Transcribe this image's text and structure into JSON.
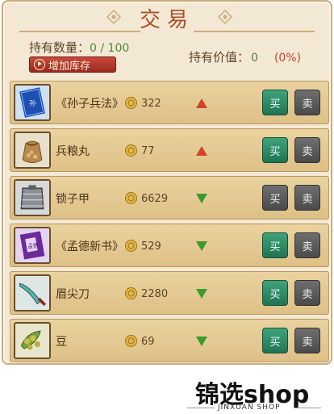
{
  "header": {
    "title": "交易"
  },
  "holdings": {
    "label": "持有数量：",
    "count": "0 / 100"
  },
  "add_storage": {
    "label": "增加库存"
  },
  "holding_value": {
    "label": "持有价值：",
    "value": "0",
    "percent": "(0%)"
  },
  "buttons": {
    "buy_label": "买",
    "sell_label": "卖"
  },
  "colors": {
    "trend_up": "#d2432b",
    "trend_down": "#3a9a2a",
    "button_active": "#2d8a63",
    "button_disabled": "#5a5a5a"
  },
  "items": [
    {
      "name": "《孙子兵法》",
      "price": "322",
      "trend": "up",
      "icon": "blue-book-icon",
      "buy_enabled": true,
      "sell_enabled": false
    },
    {
      "name": "兵粮丸",
      "price": "77",
      "trend": "up",
      "icon": "grain-sack-icon",
      "buy_enabled": true,
      "sell_enabled": false
    },
    {
      "name": "锁子甲",
      "price": "6629",
      "trend": "down",
      "icon": "chainmail-icon",
      "buy_enabled": false,
      "sell_enabled": false
    },
    {
      "name": "《孟德新书》",
      "price": "529",
      "trend": "down",
      "icon": "purple-book-icon",
      "buy_enabled": true,
      "sell_enabled": false
    },
    {
      "name": "眉尖刀",
      "price": "2280",
      "trend": "down",
      "icon": "blade-icon",
      "buy_enabled": true,
      "sell_enabled": false
    },
    {
      "name": "豆",
      "price": "69",
      "trend": "down",
      "icon": "beans-icon",
      "buy_enabled": true,
      "sell_enabled": false
    }
  ],
  "watermark": {
    "text": "锦选shop",
    "subtext": "JINXUAN SHOP"
  }
}
